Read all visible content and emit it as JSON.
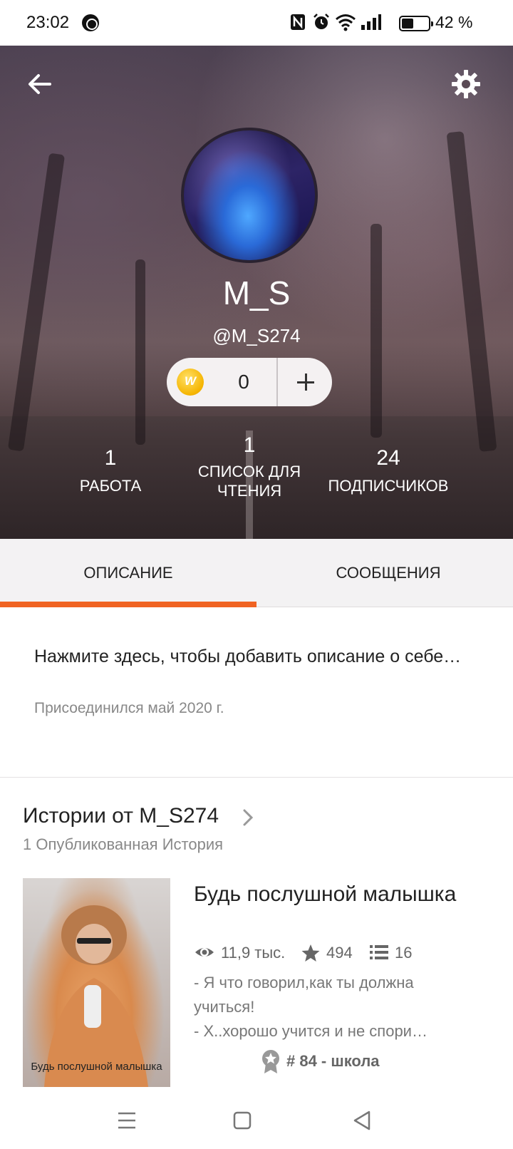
{
  "status_bar": {
    "time": "23:02",
    "battery_percent": "42 %",
    "icons": [
      "shazam-icon",
      "nfc-icon",
      "alarm-icon",
      "wifi-icon",
      "signal-icon",
      "battery-icon"
    ]
  },
  "profile": {
    "display_name": "M_S",
    "handle": "@M_S274",
    "coins": "0",
    "stats": [
      {
        "value": "1",
        "label": "РАБОТА"
      },
      {
        "value": "1",
        "label": "СПИСОК ДЛЯ ЧТЕНИЯ"
      },
      {
        "value": "24",
        "label": "ПОДПИСЧИКОВ"
      }
    ]
  },
  "tabs": [
    {
      "label": "ОПИСАНИЕ",
      "active": true
    },
    {
      "label": "СООБЩЕНИЯ",
      "active": false
    }
  ],
  "about": {
    "prompt": "Нажмите здесь, чтобы добавить описание о себе…",
    "joined": "Присоединился май 2020 г."
  },
  "stories": {
    "title": "Истории от M_S274",
    "count_label": "1 Опубликованная История",
    "items": [
      {
        "cover_caption": "Будь послушной малышка",
        "title": "Будь послушной малышка",
        "reads": "11,9 тыс.",
        "votes": "494",
        "parts": "16",
        "excerpt": "- Я что говорил,как ты должна учиться!\n- Х..хорошо учится и не спори…",
        "rank": "# 84 - школа"
      }
    ]
  },
  "colors": {
    "accent": "#f06322",
    "tab_bg": "#f3f2f3"
  }
}
